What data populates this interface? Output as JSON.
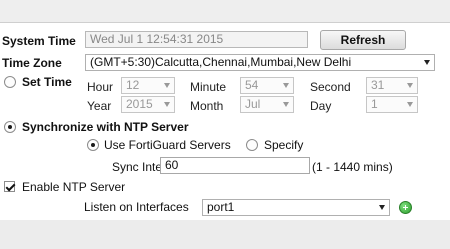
{
  "system_time": {
    "label": "System Time",
    "value": "Wed Jul  1 12:54:31 2015",
    "refresh_label": "Refresh"
  },
  "time_zone": {
    "label": "Time Zone",
    "value": "(GMT+5:30)Calcutta,Chennai,Mumbai,New Delhi"
  },
  "set_time": {
    "label": "Set Time",
    "selected": false,
    "hour": {
      "label": "Hour",
      "value": "12"
    },
    "minute": {
      "label": "Minute",
      "value": "54"
    },
    "second": {
      "label": "Second",
      "value": "31"
    },
    "year": {
      "label": "Year",
      "value": "2015"
    },
    "month": {
      "label": "Month",
      "value": "Jul"
    },
    "day": {
      "label": "Day",
      "value": "1"
    }
  },
  "ntp": {
    "label": "Synchronize with NTP Server",
    "selected": true,
    "use_fortiguard_label": "Use FortiGuard Servers",
    "use_fortiguard_selected": true,
    "specify_label": "Specify",
    "specify_selected": false,
    "sync_interval_label": "Sync Interval",
    "sync_interval_value": "60",
    "sync_interval_range": "(1 - 1440 mins)"
  },
  "enable_ntp_server": {
    "label": "Enable NTP Server",
    "checked": true,
    "listen_label": "Listen on Interfaces",
    "listen_value": "port1"
  },
  "icons": {
    "add": "add-icon",
    "dropdown": "chevron-down-icon"
  }
}
